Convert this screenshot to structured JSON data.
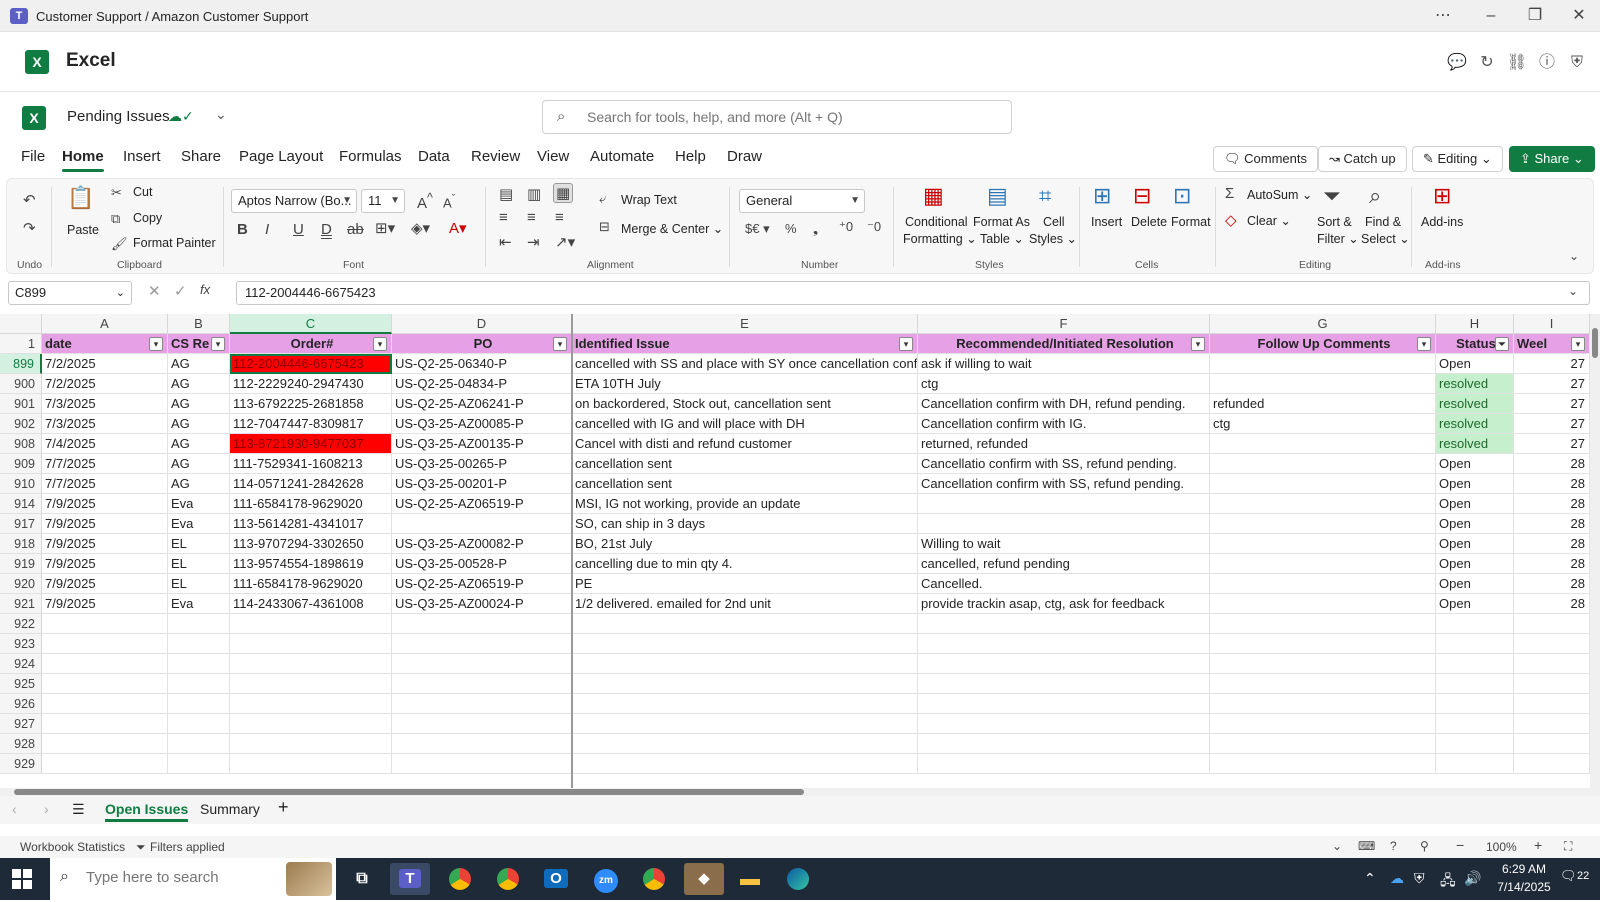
{
  "window": {
    "title": "Customer Support / Amazon Customer Support"
  },
  "app": {
    "name": "Excel",
    "doc_name": "Pending Issues",
    "search_placeholder": "Search for tools, help, and more (Alt + Q)"
  },
  "menu": {
    "tabs": [
      "File",
      "Home",
      "Insert",
      "Share",
      "Page Layout",
      "Formulas",
      "Data",
      "Review",
      "View",
      "Automate",
      "Help",
      "Draw"
    ],
    "active": "Home",
    "comments": "Comments",
    "catchup": "Catch up",
    "editing": "Editing",
    "share": "Share"
  },
  "ribbon": {
    "undo": "Undo",
    "paste": "Paste",
    "cut": "Cut",
    "copy": "Copy",
    "format_painter": "Format Painter",
    "clipboard": "Clipboard",
    "font_name": "Aptos Narrow (Bo...",
    "font_size": "11",
    "font": "Font",
    "wrap_text": "Wrap Text",
    "merge_center": "Merge & Center",
    "alignment": "Alignment",
    "number_format": "General",
    "number": "Number",
    "conditional_formatting_1": "Conditional",
    "conditional_formatting_2": "Formatting",
    "format_as_table_1": "Format As",
    "format_as_table_2": "Table",
    "cell_styles_1": "Cell",
    "cell_styles_2": "Styles",
    "styles": "Styles",
    "insert": "Insert",
    "delete": "Delete",
    "format": "Format",
    "cells": "Cells",
    "autosum": "AutoSum",
    "clear": "Clear",
    "sort_filter_1": "Sort &",
    "sort_filter_2": "Filter",
    "find_select_1": "Find &",
    "find_select_2": "Select",
    "editing": "Editing",
    "addins": "Add-ins",
    "addins_group": "Add-ins"
  },
  "formula_bar": {
    "name_box": "C899",
    "content": "112-2004446-6675423"
  },
  "grid": {
    "columns": [
      "A",
      "B",
      "C",
      "D",
      "E",
      "F",
      "G",
      "H",
      "I"
    ],
    "header_row_number": "1",
    "headers": [
      "date",
      "CS Re",
      "Order#",
      "PO",
      "Identified Issue",
      "Recommended/Initiated Resolution",
      "Follow Up Comments",
      "Status",
      "Weel"
    ],
    "rows": [
      {
        "n": "899",
        "a": "7/2/2025",
        "b": "AG",
        "c": "112-2004446-6675423",
        "d": "US-Q2-25-06340-P",
        "e": "cancelled with SS and place with SY once cancellation conf",
        "f": "ask if willing to wait",
        "g": "",
        "h": "Open",
        "i": "27"
      },
      {
        "n": "900",
        "a": "7/2/2025",
        "b": "AG",
        "c": "112-2229240-2947430",
        "d": "US-Q2-25-04834-P",
        "e": "ETA 10TH July",
        "f": "ctg",
        "g": "",
        "h": "resolved",
        "i": "27"
      },
      {
        "n": "901",
        "a": "7/3/2025",
        "b": "AG",
        "c": "113-6792225-2681858",
        "d": "US-Q2-25-AZ06241-P",
        "e": "on backordered, Stock out, cancellation sent",
        "f": "Cancellation confirm with DH, refund pending.",
        "g": "refunded",
        "h": "resolved",
        "i": "27"
      },
      {
        "n": "902",
        "a": "7/3/2025",
        "b": "AG",
        "c": "112-7047447-8309817",
        "d": "US-Q3-25-AZ00085-P",
        "e": "cancelled with IG and will place with DH",
        "f": "Cancellation confirm with IG.",
        "g": "ctg",
        "h": "resolved",
        "i": "27"
      },
      {
        "n": "908",
        "a": "7/4/2025",
        "b": "AG",
        "c": "113-8721930-9477037",
        "d": "US-Q3-25-AZ00135-P",
        "e": "Cancel with disti and refund customer",
        "f": "returned, refunded",
        "g": "",
        "h": "resolved",
        "i": "27"
      },
      {
        "n": "909",
        "a": "7/7/2025",
        "b": "AG",
        "c": "111-7529341-1608213",
        "d": "US-Q3-25-00265-P",
        "e": "cancellation sent",
        "f": "Cancellatio confirm with SS, refund pending.",
        "g": "",
        "h": "Open",
        "i": "28"
      },
      {
        "n": "910",
        "a": "7/7/2025",
        "b": "AG",
        "c": "114-0571241-2842628",
        "d": "US-Q3-25-00201-P",
        "e": "cancellation sent",
        "f": "Cancellation confirm with SS, refund pending.",
        "g": "",
        "h": "Open",
        "i": "28"
      },
      {
        "n": "914",
        "a": "7/9/2025",
        "b": "Eva",
        "c": "111-6584178-9629020",
        "d": "US-Q2-25-AZ06519-P",
        "e": "MSI, IG not working, provide an update",
        "f": "",
        "g": "",
        "h": "Open",
        "i": "28"
      },
      {
        "n": "917",
        "a": "7/9/2025",
        "b": "Eva",
        "c": "113-5614281-4341017",
        "d": "",
        "e": "SO, can ship in 3 days",
        "f": "",
        "g": "",
        "h": "Open",
        "i": "28"
      },
      {
        "n": "918",
        "a": "7/9/2025",
        "b": "EL",
        "c": "113-9707294-3302650",
        "d": "US-Q3-25-AZ00082-P",
        "e": "BO, 21st July",
        "f": "Willing to wait",
        "g": "",
        "h": "Open",
        "i": "28"
      },
      {
        "n": "919",
        "a": "7/9/2025",
        "b": "EL",
        "c": "113-9574554-1898619",
        "d": "US-Q3-25-00528-P",
        "e": "cancelling due to min qty 4.",
        "f": "cancelled, refund pending",
        "g": "",
        "h": "Open",
        "i": "28"
      },
      {
        "n": "920",
        "a": "7/9/2025",
        "b": "EL",
        "c": "111-6584178-9629020",
        "d": "US-Q2-25-AZ06519-P",
        "e": "PE",
        "f": "Cancelled.",
        "g": "",
        "h": "Open",
        "i": "28"
      },
      {
        "n": "921",
        "a": "7/9/2025",
        "b": "Eva",
        "c": "114-2433067-4361008",
        "d": "US-Q3-25-AZ00024-P",
        "e": "1/2 delivered. emailed for 2nd unit",
        "f": "provide trackin asap, ctg, ask for feedback",
        "g": "",
        "h": "Open",
        "i": "28"
      }
    ],
    "empty_rows": [
      "922",
      "923",
      "924",
      "925",
      "926",
      "927",
      "928",
      "929"
    ]
  },
  "sheets": {
    "tabs": [
      "Open Issues",
      "Summary"
    ],
    "active": "Open Issues"
  },
  "status": {
    "workbook_stats": "Workbook Statistics",
    "filters": "Filters applied",
    "zoom": "100%"
  },
  "taskbar": {
    "search_placeholder": "Type here to search",
    "time": "6:29 AM",
    "date": "7/14/2025",
    "notifications": "22"
  }
}
